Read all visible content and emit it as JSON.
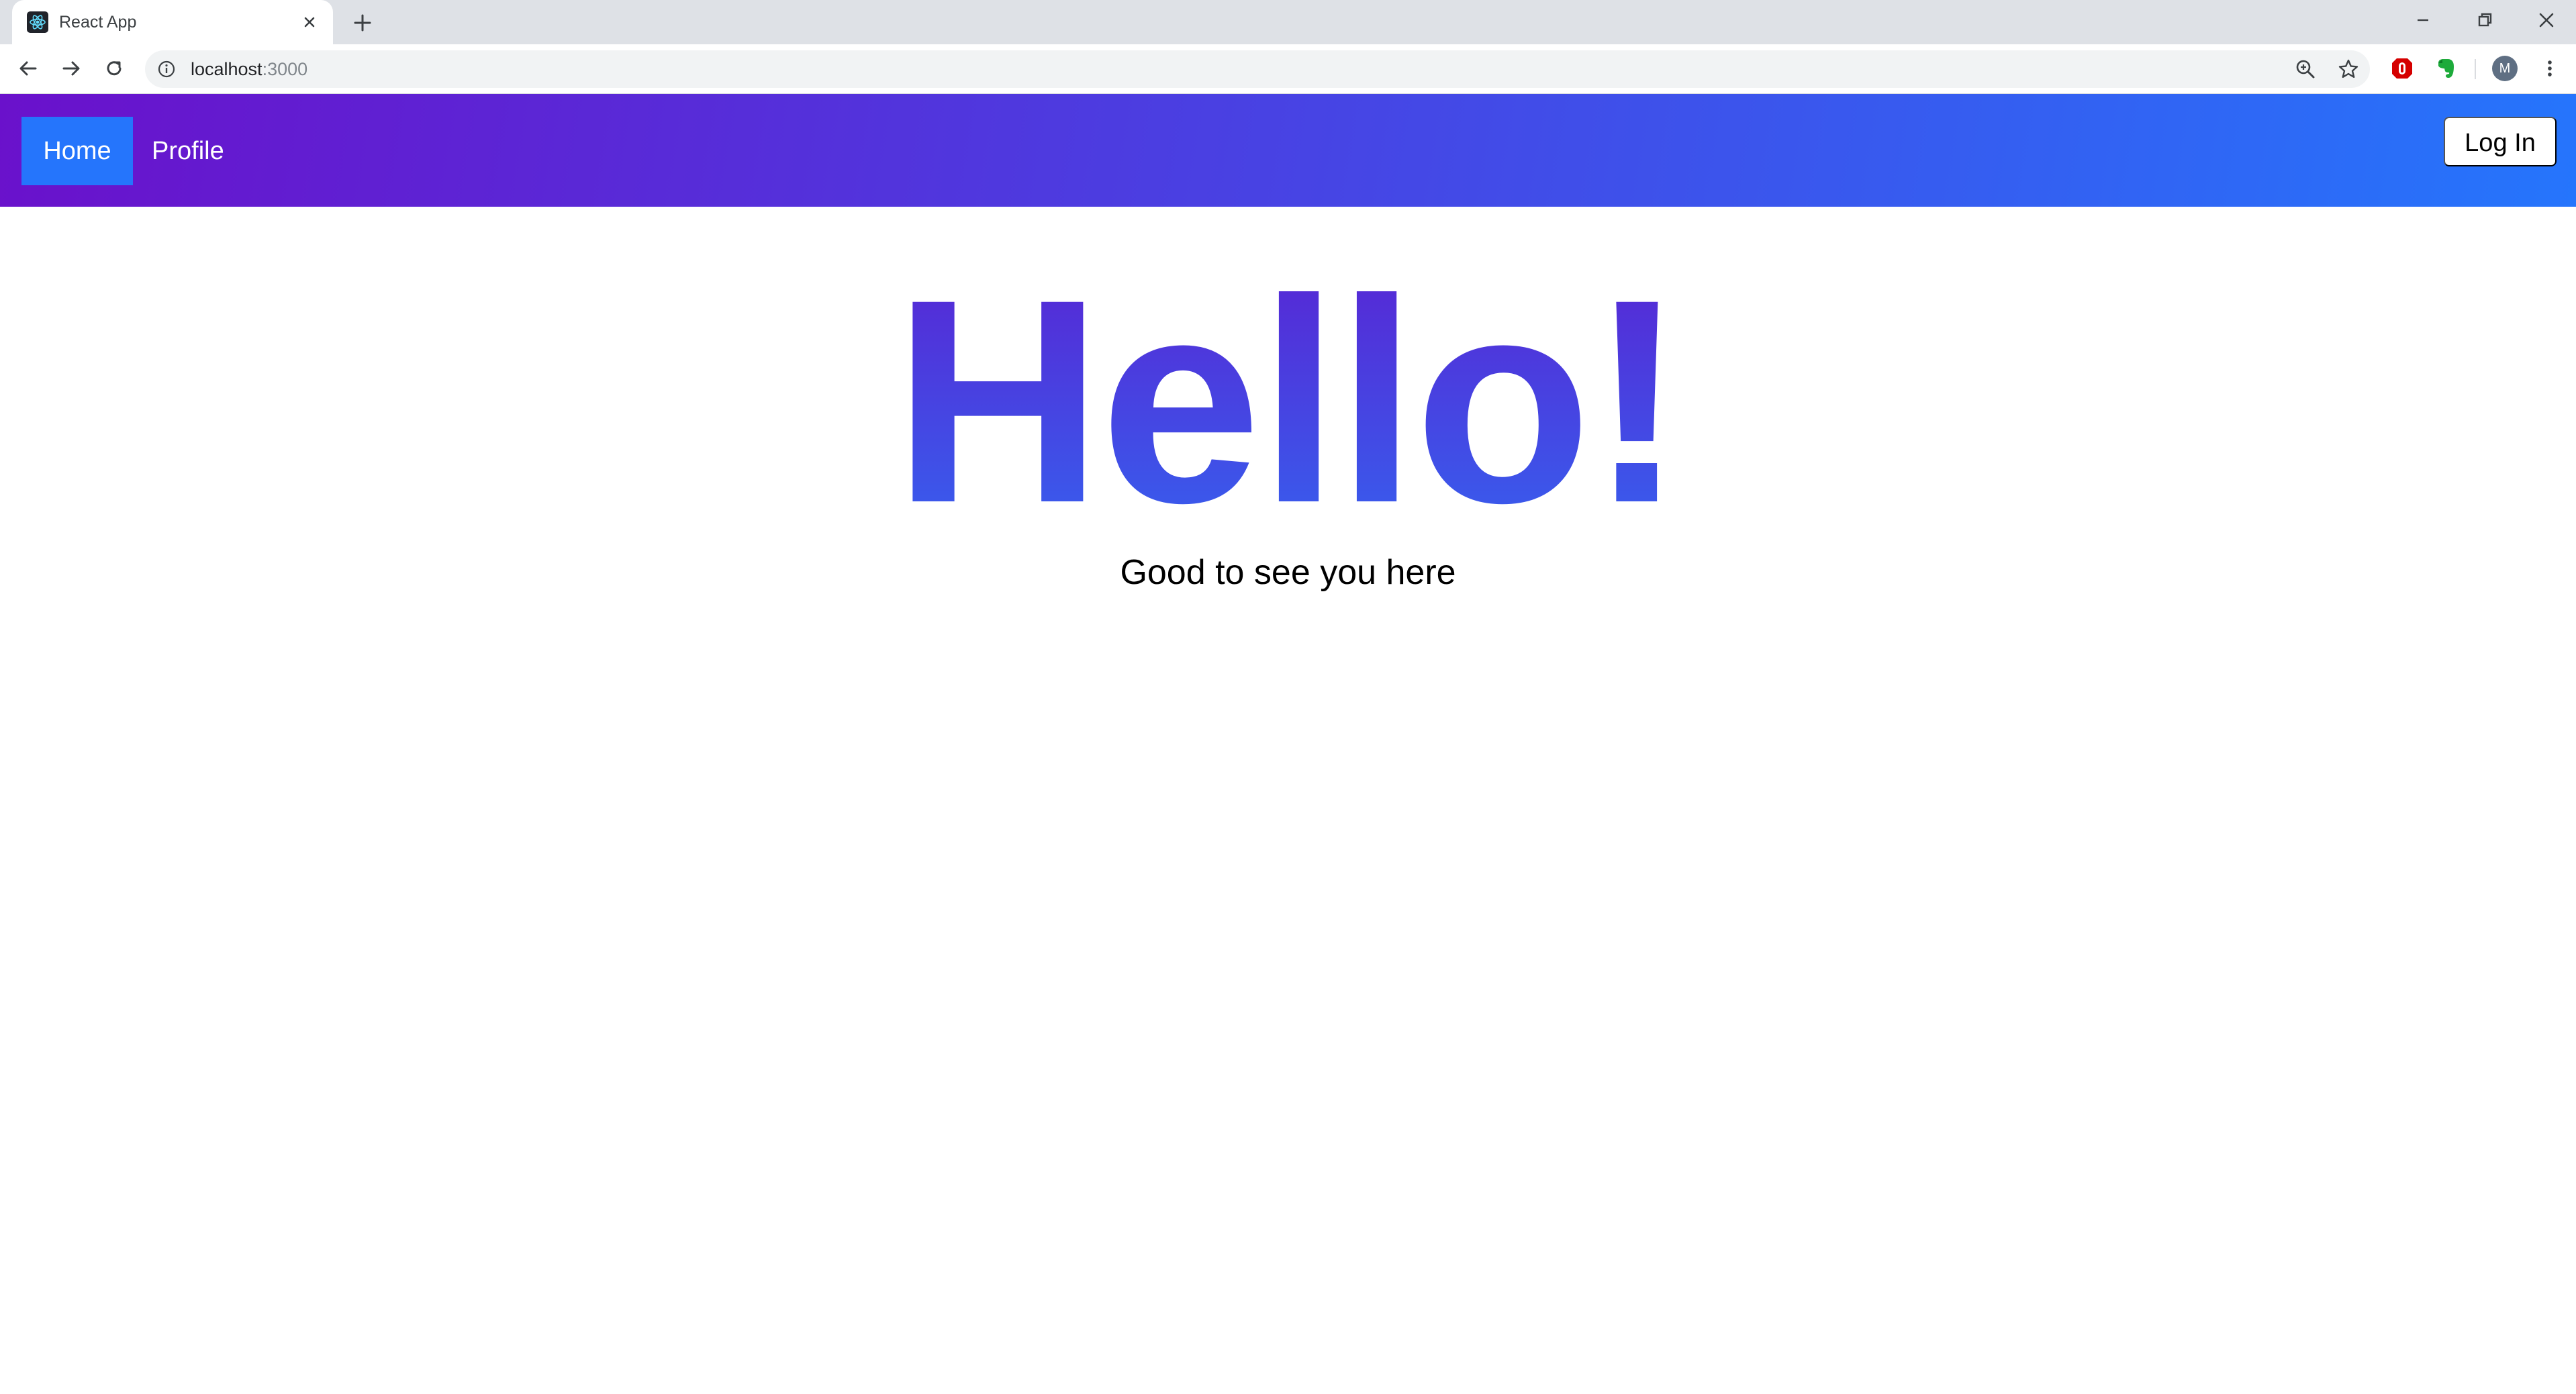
{
  "browser": {
    "tab": {
      "title": "React App",
      "favicon": "react-logo-icon"
    },
    "url": {
      "host": "localhost",
      "rest": ":3000"
    },
    "profile_initial": "M",
    "extensions": [
      "ublock-icon",
      "evernote-icon"
    ]
  },
  "navbar": {
    "items": [
      {
        "label": "Home",
        "active": true
      },
      {
        "label": "Profile",
        "active": false
      }
    ],
    "login_label": "Log In",
    "gradient": [
      "#6a11cb",
      "#2575fc"
    ],
    "active_color": "#2575fc"
  },
  "hero": {
    "title": "Hello!",
    "subtitle": "Good to see you here",
    "title_gradient": [
      "#5a22d2",
      "#3463f0"
    ]
  }
}
